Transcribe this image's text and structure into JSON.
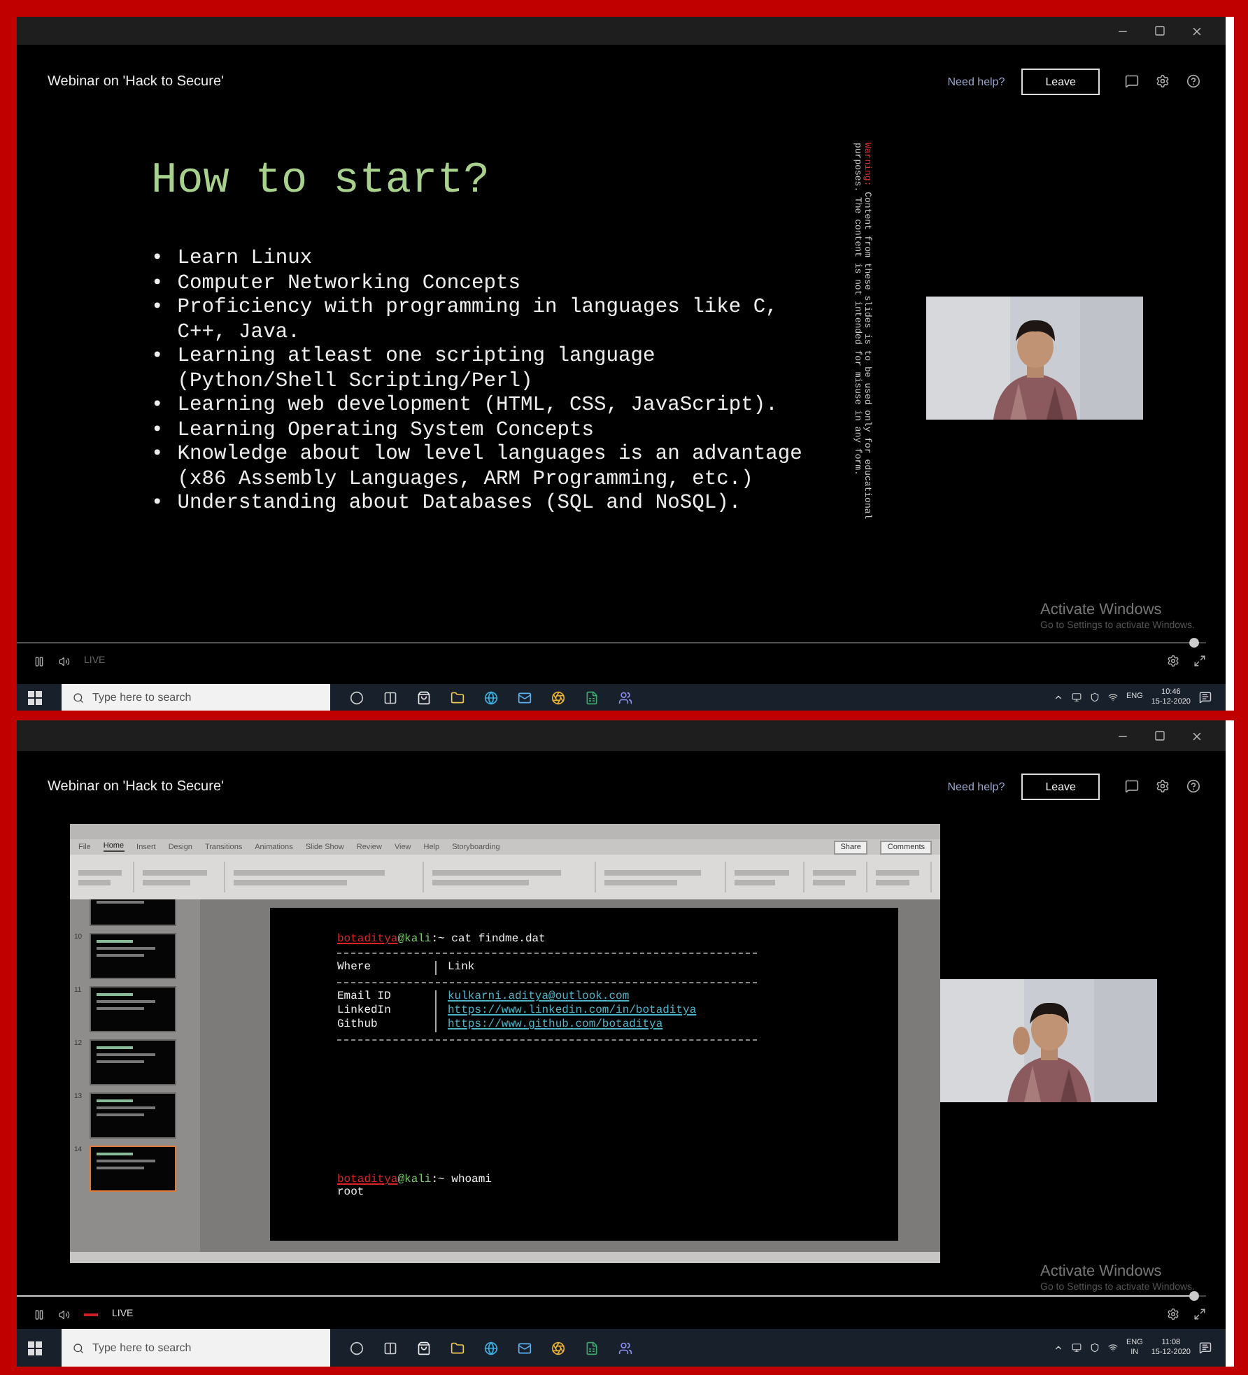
{
  "screens": [
    {
      "kind": "slide",
      "window": {
        "title": "Webinar on 'Hack to Secure'"
      },
      "header": {
        "help": "Need help?",
        "leave_button": "Leave"
      },
      "slide": {
        "title": "How to start?",
        "bullets": [
          {
            "marker": "•",
            "text": "Learn Linux"
          },
          {
            "marker": "•",
            "text": "Computer Networking Concepts"
          },
          {
            "marker": "•",
            "text": "Proficiency with programming in languages like C, C++, Java."
          },
          {
            "marker": "•",
            "text": "Learning atleast one scripting language (Python/Shell Scripting/Perl)"
          },
          {
            "marker": "•",
            "text": "Learning web development (HTML, CSS, JavaScript)."
          },
          {
            "marker": "•",
            "text": "Learning Operating System Concepts"
          },
          {
            "marker": "•",
            "text": "Knowledge about low level languages is an advantage (x86 Assembly Languages, ARM Programming, etc.)"
          },
          {
            "marker": "•",
            "text": "Understanding about Databases (SQL and NoSQL)."
          }
        ],
        "disclaimer": {
          "label": "Warning:",
          "text": " Content from these slides is to be used only for educational purposes. The content is not intended for misuse in any form."
        }
      },
      "activation": {
        "title": "Activate Windows",
        "hint": "Go to Settings to activate Windows."
      },
      "player": {
        "status": "LIVE",
        "live": false,
        "level": 0.99
      },
      "taskbar": {
        "search_placeholder": "Type here to search",
        "language": "ENG",
        "time": "10:46",
        "date": "15-12-2020"
      }
    },
    {
      "kind": "editor",
      "window": {
        "title": "Webinar on 'Hack to Secure'"
      },
      "header": {
        "help": "Need help?",
        "leave_button": "Leave"
      },
      "editor": {
        "tabs": [
          {
            "label": "File",
            "selected": false
          },
          {
            "label": "Home",
            "selected": true
          },
          {
            "label": "Insert",
            "selected": false
          },
          {
            "label": "Design",
            "selected": false
          },
          {
            "label": "Transitions",
            "selected": false
          },
          {
            "label": "Animations",
            "selected": false
          },
          {
            "label": "Slide Show",
            "selected": false
          },
          {
            "label": "Review",
            "selected": false
          },
          {
            "label": "View",
            "selected": false
          },
          {
            "label": "Help",
            "selected": false
          },
          {
            "label": "Storyboarding",
            "selected": false
          }
        ],
        "share_button": "Share",
        "comments_button": "Comments",
        "thumbnails": [
          {
            "selected": false
          },
          {
            "number": "10",
            "selected": false
          },
          {
            "number": "11",
            "selected": false
          },
          {
            "number": "12",
            "selected": false
          },
          {
            "number": "13",
            "selected": false
          },
          {
            "number": "14",
            "selected": true
          }
        ],
        "terminal": {
          "prompts": [
            {
              "user": "botaditya",
              "host": "@kali",
              "symbol": ":~",
              "command": " cat findme.dat"
            },
            {
              "user": "botaditya",
              "host": "@kali",
              "symbol": ":~",
              "command": " whoami",
              "output": "root"
            }
          ],
          "table": {
            "columns": [
              "Where",
              "Link"
            ],
            "rows": [
              [
                "Email ID",
                "kulkarni.aditya@outlook.com"
              ],
              [
                "LinkedIn",
                "https://www.linkedin.com/in/botaditya"
              ],
              [
                "Github",
                "https://www.github.com/botaditya"
              ]
            ]
          }
        }
      },
      "activation": {
        "title": "Activate Windows",
        "hint": "Go to Settings to activate Windows."
      },
      "player": {
        "status": "LIVE",
        "live": true,
        "level": 0.99
      },
      "taskbar": {
        "search_placeholder": "Type here to search",
        "language": "ENG",
        "region": "IN",
        "time": "11:08",
        "date": "15-12-2020"
      }
    }
  ]
}
